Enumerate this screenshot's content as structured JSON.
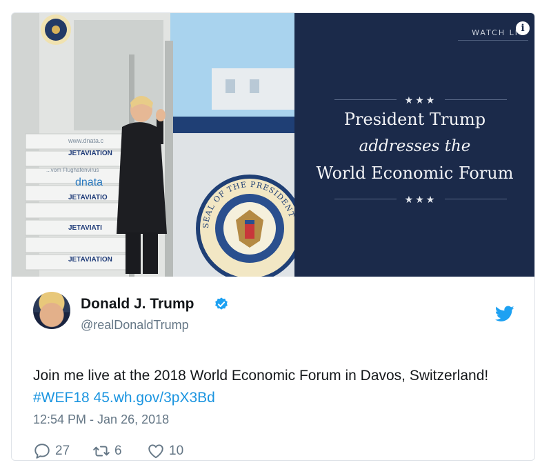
{
  "media": {
    "watch_live": "WATCH LI",
    "info_icon": "info-icon",
    "stars": "★★★",
    "headline_line1": "President Trump",
    "headline_line2": "addresses the",
    "headline_line3": "World Economic Forum",
    "seal_text": "SEAL OF THE PRESIDENT OF THE UNITED STATES",
    "stair_labels": [
      "www.dnata.c",
      "JETAVIATION",
      "...vom Flughafenvirus",
      "dnata",
      "JETAVIATIO",
      "JETAVIATI",
      "JETAVIATION"
    ]
  },
  "tweet": {
    "name": "Donald J. Trump",
    "handle": "@realDonaldTrump",
    "text_plain": "Join me live at the 2018 World Economic Forum in Davos, Switzerland! ",
    "hashtag": "#WEF18",
    "url": "45.wh.gov/3pX3Bd",
    "timestamp": "12:54 PM - Jan 26, 2018",
    "replies": "27",
    "retweets": "6",
    "likes": "10"
  },
  "colors": {
    "panel_bg": "#1b2a4a",
    "link": "#1b95e0",
    "twitter_blue": "#1da1f2",
    "muted": "#657786"
  }
}
